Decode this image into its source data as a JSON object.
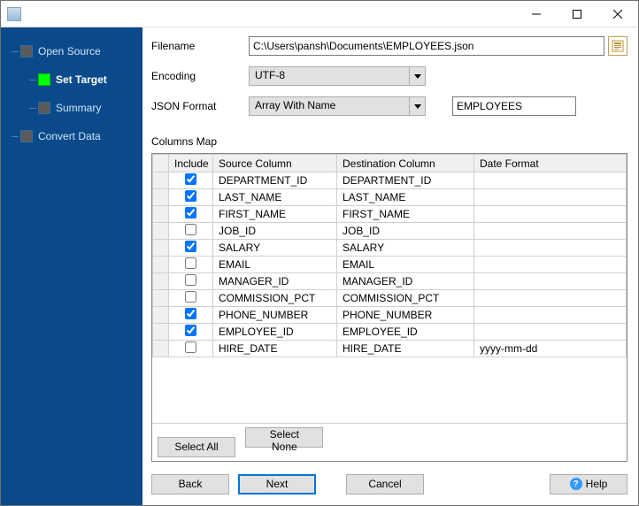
{
  "sidebar": {
    "items": [
      {
        "label": "Open Source",
        "active": false,
        "indent": 0
      },
      {
        "label": "Set Target",
        "active": true,
        "indent": 1
      },
      {
        "label": "Summary",
        "active": false,
        "indent": 1
      },
      {
        "label": "Convert Data",
        "active": false,
        "indent": 0
      }
    ]
  },
  "form": {
    "filename_label": "Filename",
    "filename_value": "C:\\Users\\pansh\\Documents\\EMPLOYEES.json",
    "encoding_label": "Encoding",
    "encoding_value": "UTF-8",
    "json_format_label": "JSON Format",
    "json_format_value": "Array With Name",
    "json_name_value": "EMPLOYEES"
  },
  "columns_header": "Columns Map",
  "grid": {
    "headers": {
      "include": "Include",
      "source": "Source Column",
      "dest": "Destination Column",
      "datefmt": "Date Format"
    },
    "rows": [
      {
        "include": true,
        "source": "DEPARTMENT_ID",
        "dest": "DEPARTMENT_ID",
        "datefmt": ""
      },
      {
        "include": true,
        "source": "LAST_NAME",
        "dest": "LAST_NAME",
        "datefmt": ""
      },
      {
        "include": true,
        "source": "FIRST_NAME",
        "dest": "FIRST_NAME",
        "datefmt": ""
      },
      {
        "include": false,
        "source": "JOB_ID",
        "dest": "JOB_ID",
        "datefmt": ""
      },
      {
        "include": true,
        "source": "SALARY",
        "dest": "SALARY",
        "datefmt": ""
      },
      {
        "include": false,
        "source": "EMAIL",
        "dest": "EMAIL",
        "datefmt": ""
      },
      {
        "include": false,
        "source": "MANAGER_ID",
        "dest": "MANAGER_ID",
        "datefmt": ""
      },
      {
        "include": false,
        "source": "COMMISSION_PCT",
        "dest": "COMMISSION_PCT",
        "datefmt": ""
      },
      {
        "include": true,
        "source": "PHONE_NUMBER",
        "dest": "PHONE_NUMBER",
        "datefmt": ""
      },
      {
        "include": true,
        "source": "EMPLOYEE_ID",
        "dest": "EMPLOYEE_ID",
        "datefmt": ""
      },
      {
        "include": false,
        "source": "HIRE_DATE",
        "dest": "HIRE_DATE",
        "datefmt": "yyyy-mm-dd"
      }
    ]
  },
  "buttons": {
    "select_all": "Select All",
    "select_none": "Select None",
    "back": "Back",
    "next": "Next",
    "cancel": "Cancel",
    "help": "Help"
  }
}
